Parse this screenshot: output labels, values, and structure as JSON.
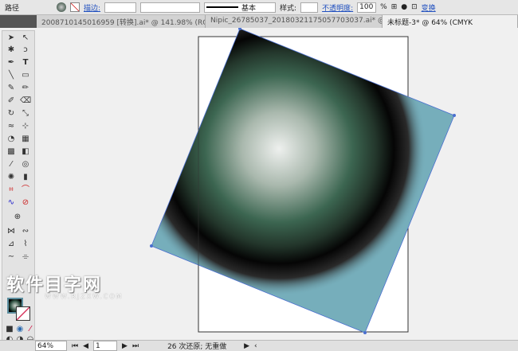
{
  "control_bar": {
    "object_type": "路径",
    "stroke_label": "描边:",
    "stroke_style": "基本",
    "style_label": "样式:",
    "opacity_label": "不透明度:",
    "opacity_value": "100",
    "opacity_unit": "%",
    "transform_label": "变换"
  },
  "tabs": [
    {
      "label": "2008710145016959 [转换].ai* @ 141.98% (RGB/...",
      "active": false
    },
    {
      "label": "Nipic_26785037_20180321175057703037.ai* @ 100% (CMYK/...",
      "active": false
    },
    {
      "label": "未标题-3* @ 64% (CMYK",
      "active": true
    }
  ],
  "status": {
    "zoom": "64%",
    "page": "1",
    "undo_text": "26 次还原; 无重做"
  },
  "watermark": {
    "text": "软件目字网",
    "url": "WWW.RJZXW.COM"
  },
  "colors": {
    "fill_square": "#76aebb",
    "sphere_center": "#e8ece8",
    "sphere_mid": "#3f6a55",
    "ring": "#050505",
    "selection": "#4a6fd0"
  }
}
